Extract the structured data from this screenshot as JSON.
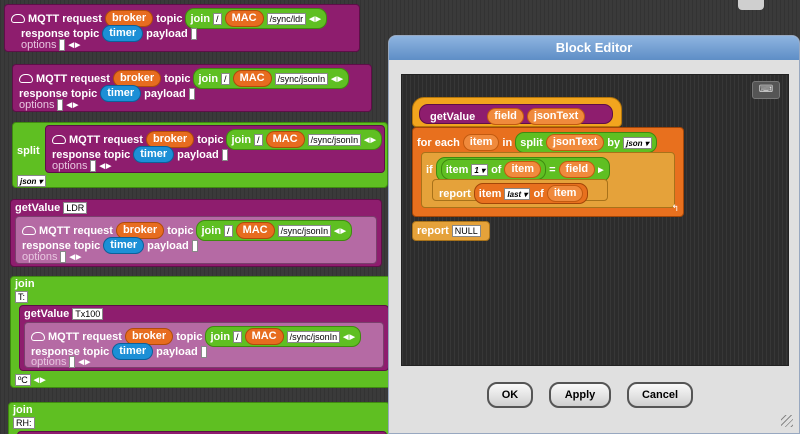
{
  "mqtt": {
    "title": "MQTT request",
    "broker": "broker",
    "topic": "topic",
    "join": "join",
    "slash": "/",
    "mac": "MAC",
    "response_topic": "response topic",
    "timer": "timer",
    "payload": "payload",
    "options": "options"
  },
  "blocks": {
    "b1_path": "/sync/ldr",
    "b2_path": "/sync/jsonIn",
    "split": "split",
    "b3_path": "/sync/jsonIn",
    "json_opt": "json",
    "getvalue": "getValue",
    "ldr": "LDR",
    "b4_path": "/sync/jsonIn",
    "join_label": "join",
    "t_slot": "T:",
    "tx100": "Tx100",
    "b5_path": "/sync/jsonIn",
    "celsius": "ºC",
    "rh_slot": "RH:"
  },
  "editor": {
    "title": "Block Editor",
    "keyboard_icon": "keyboard-icon",
    "getvalue": "getValue",
    "field": "field",
    "jsontext": "jsonText",
    "for_each": "for each",
    "item": "item",
    "in": "in",
    "split": "split",
    "by": "by",
    "json": "json",
    "if": "if",
    "item_label": "item",
    "index": "1",
    "of": "of",
    "eq": "=",
    "report": "report",
    "last": "last",
    "report_null": "report",
    "null": "NULL",
    "ok": "OK",
    "apply": "Apply",
    "cancel": "Cancel"
  }
}
